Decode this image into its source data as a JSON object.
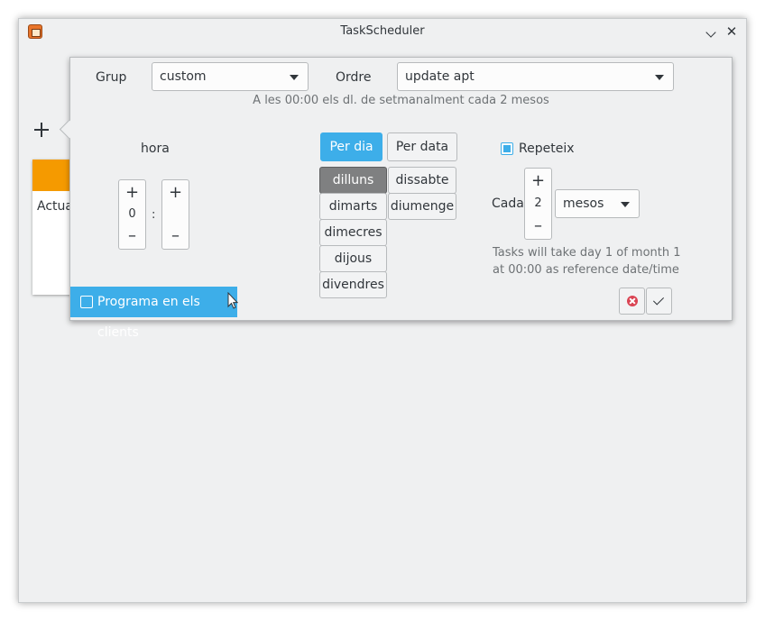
{
  "window": {
    "title": "TaskScheduler"
  },
  "card": {
    "text": "Actua"
  },
  "form": {
    "group_label": "Grup",
    "group_value": "custom",
    "command_label": "Ordre",
    "command_value": "update apt",
    "summary": "A les 00:00 els dl. de setmanalment cada 2  mesos",
    "hour_label": "hora",
    "hour_value": "0",
    "minute_value": "",
    "time_separator": ":",
    "tabs": {
      "per_day": "Per dia",
      "per_date": "Per data",
      "active": "per_day"
    },
    "days": [
      "dilluns",
      "dimarts",
      "dimecres",
      "dijous",
      "divendres",
      "dissabte",
      "diumenge"
    ],
    "selected_day": "dilluns",
    "repeat_label": "Repeteix",
    "repeat_checked": true,
    "every_label": "Cada",
    "every_value": "2",
    "unit_value": "mesos",
    "note_line1": "Tasks will take day 1 of month 1",
    "note_line2": "at 00:00 as reference date/time",
    "clients_label": "Programa en els clients",
    "clients_checked": false
  },
  "colors": {
    "accent": "#3daee9",
    "card_header": "#f59a00",
    "cancel": "#da4453"
  }
}
